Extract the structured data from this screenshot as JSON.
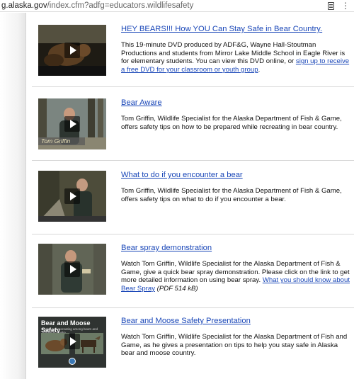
{
  "browser": {
    "url_prefix": "g.alaska.gov",
    "url_path": "/index.cfm?adfg=educators.wildlifesafety",
    "reader_icon": "reader-view-icon",
    "menu_icon": "more-icon"
  },
  "videos": [
    {
      "title": "HEY BEARS!!! How YOU Can Stay Safe in Bear Country.",
      "desc_text": "This 19-minute DVD produced by ADF&G, Wayne Hall-Stoutman Productions and students from Mirror Lake Middle School in Eagle River is for elementary students. You can view this DVD online, or ",
      "desc_link": "sign up to receive a free DVD for your classroom or youth group",
      "desc_after": "."
    },
    {
      "title": "Bear Aware",
      "desc_text": "Tom Griffin, Wildlife Specialist for the Alaska Department of Fish & Game, offers safety tips on how to be prepared while recreating in bear country.",
      "thumb_name": "Tom Griffin"
    },
    {
      "title": "What to do if you encounter a bear",
      "desc_text": "Tom Griffin, Wildlife Specialist for the Alaska Department of Fish & Game, offers safety tips on what to do if you encounter a bear."
    },
    {
      "title": "Bear spray demonstration",
      "desc_text": "Watch Tom Griffin, Wildlife Specialist for the Alaska Department of Fish & Game, give a quick bear spray demonstration. Please click on the link to get more detailed information on using bear spray. ",
      "desc_link": "What you should know about Bear Spray",
      "desc_note": "(PDF 514 kB)"
    },
    {
      "title": "Bear and Moose Safety Presentation",
      "desc_text": "Watch Tom Griffin, Wildlife Specialist for the Alaska Department of Fish and Game, as he gives a presentation on tips to help you stay safe in Alaska bear and moose country.",
      "thumb_title": "Bear and Moose Safety",
      "thumb_subtitle": "Living and recreating among bears and moose in Alaska"
    }
  ]
}
